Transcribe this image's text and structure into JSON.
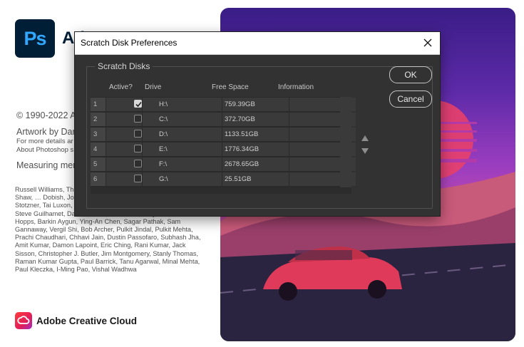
{
  "splash": {
    "logo_text": "Ps",
    "app_name": "Ad",
    "copyright": "© 1990-2022 A",
    "artwork": "Artwork by Dar",
    "more_details": "For more details ar",
    "about": "About Photoshop s",
    "measuring": "Measuring mer",
    "credits": "Russell Williams, Tho… Jackie Lincoln-Owye… Harris, Mike Shaw, … Dobish, John Peters… Brereton, Meredith Payne Stotzner, Tai Luxon, Vinod Balakrishnan, Maria Yap, Pam Clark, Steve Guilhamet, David Hackel, Eric Floch, Judy Lee, Kevin Hopps, Barkin Aygun, Ying-An Chen, Sagar Pathak, Sam Gannaway, Vergil Shi, Bob Archer, Pulkit Jindal, Pulkit Mehta, Prachi Chaudhari, Chhavi Jain, Dustin Passofaro, Subhash Jha, Amit Kumar, Damon Lapoint, Eric Ching, Rani Kumar, Jack Sisson, Christopher J. Butler, Jim Montgomery, Stanly Thomas, Raman Kumar Gupta, Paul Barrick, Tanu Agarwal, Minal Mehta, Paul Kleczka, I-Ming Pao, Vishal Wadhwa",
    "cc_icon": "creative-cloud-icon",
    "cc_name": "Adobe Creative Cloud"
  },
  "dialog": {
    "title": "Scratch Disk Preferences",
    "close_icon": "close-icon",
    "group_title": "Scratch Disks",
    "columns": {
      "active": "Active?",
      "drive": "Drive",
      "free": "Free Space",
      "info": "Information"
    },
    "rows": [
      {
        "num": "1",
        "active": true,
        "drive": "H:\\",
        "free": "759.39GB",
        "info": ""
      },
      {
        "num": "2",
        "active": false,
        "drive": "C:\\",
        "free": "372.70GB",
        "info": ""
      },
      {
        "num": "3",
        "active": false,
        "drive": "D:\\",
        "free": "1133.51GB",
        "info": ""
      },
      {
        "num": "4",
        "active": false,
        "drive": "E:\\",
        "free": "1776.34GB",
        "info": ""
      },
      {
        "num": "5",
        "active": false,
        "drive": "F:\\",
        "free": "2678.65GB",
        "info": ""
      },
      {
        "num": "6",
        "active": false,
        "drive": "G:\\",
        "free": "25.51GB",
        "info": ""
      }
    ],
    "move_up_icon": "triangle-up-icon",
    "move_down_icon": "triangle-down-icon",
    "ok_label": "OK",
    "cancel_label": "Cancel"
  },
  "colors": {
    "ps_logo_bg": "#001e36",
    "ps_logo_text": "#31a8ff",
    "dialog_bg": "#323232",
    "cell_bg": "#3a3a3a"
  }
}
